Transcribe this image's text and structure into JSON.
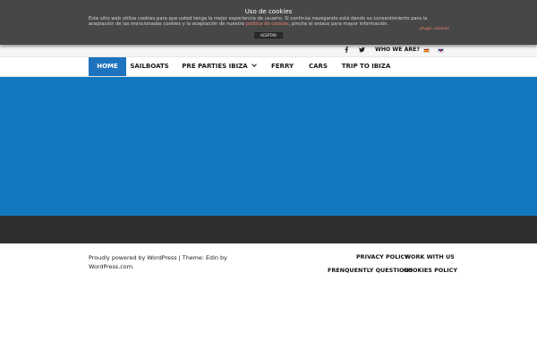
{
  "cookie_notice": {
    "title": "Uso de cookies",
    "text_before_link": "Este sitio web utiliza cookies para que usted tenga la mejor experiencia de usuario. Si continúa navegando está dando su consentimiento para la aceptación de las mencionadas cookies y la aceptación de nuestra ",
    "link_text": "política de cookies",
    "text_after_link": ", pinche el enlace para mayor información.",
    "more_link": "plugin cookies",
    "accept_label": "ACEPTAR"
  },
  "topbar": {
    "link_label": "WHO WE ARE?"
  },
  "nav": {
    "items": [
      {
        "label": "HOME"
      },
      {
        "label": "SAILBOATS"
      },
      {
        "label": "PRE PARTIES IBIZA"
      },
      {
        "label": "FERRY"
      },
      {
        "label": "CARS"
      },
      {
        "label": "TRIP TO IBIZA"
      }
    ]
  },
  "footer": {
    "credit_text": "Proudly powered by WordPress | Theme: Edin by WordPress.com.",
    "links": {
      "privacy": "PRIVACY POLICY",
      "work": "WORK WITH US",
      "faq": "FRENQUENTLY QUESTIONS",
      "cookies": "COOKIES POLICY"
    }
  },
  "colors": {
    "cookie_bar": "#474747",
    "nav_active": "#1e73be",
    "hero": "#1278c0",
    "dark_band": "#2f2f2f"
  }
}
